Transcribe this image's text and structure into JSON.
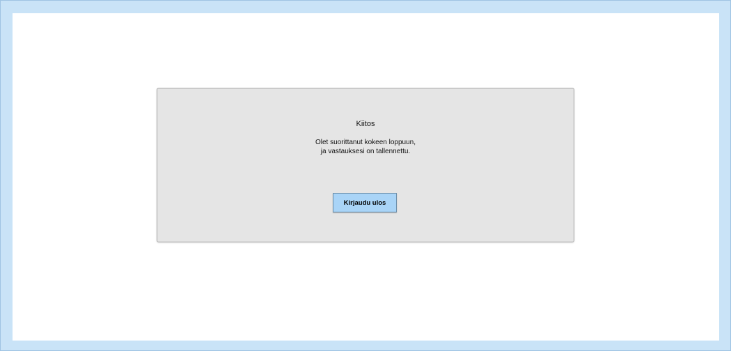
{
  "dialog": {
    "title": "Kiitos",
    "message_line_1": "Olet suorittanut kokeen loppuun,",
    "message_line_2": "ja vastauksesi on tallennettu.",
    "logout_button_label": "Kirjaudu ulos"
  },
  "colors": {
    "outer_background": "#c9e3f7",
    "content_background": "#ffffff",
    "dialog_background": "#e5e5e5",
    "button_background": "#a9d4f7"
  }
}
